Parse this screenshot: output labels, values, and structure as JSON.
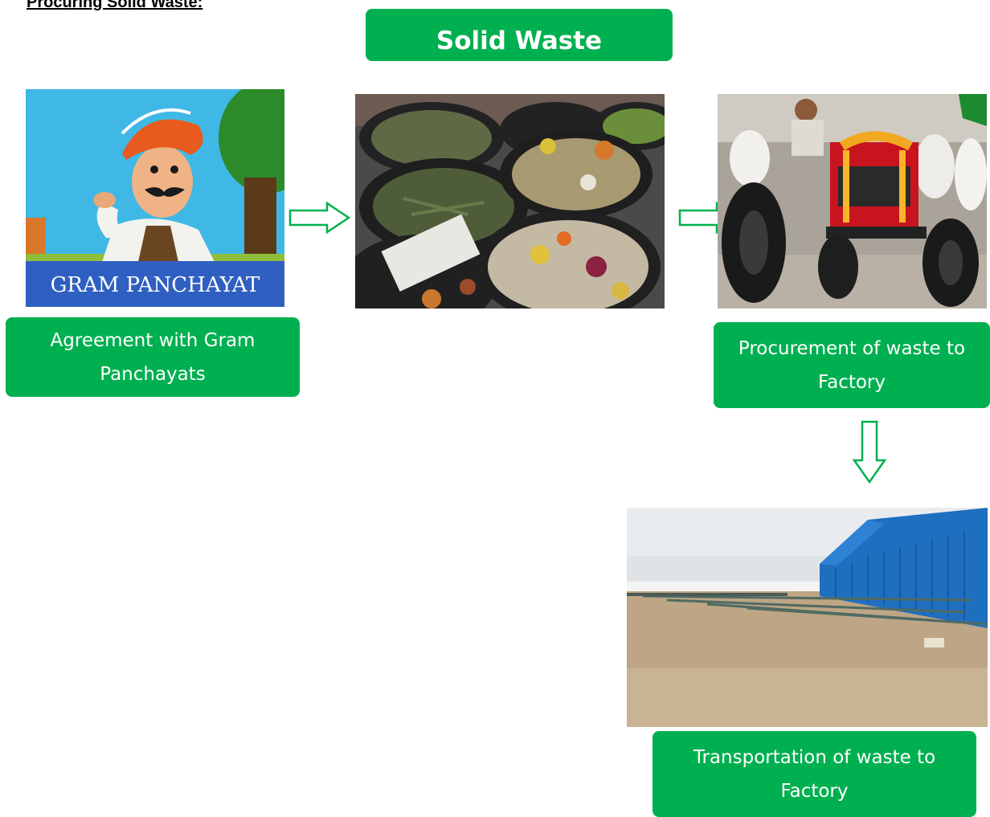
{
  "document": {
    "heading": "Procuring Solid Waste:",
    "title": "Solid Waste"
  },
  "flow": {
    "step1": {
      "image_text": "GRAM PANCHAYAT",
      "label": "Agreement with Gram Panchayats"
    },
    "step3": {
      "label": "Procurement of waste to Factory"
    },
    "step4": {
      "label": "Transportation of waste to Factory"
    }
  },
  "colors": {
    "box_green": "#00b050",
    "arrow_green": "#00b050",
    "text_white": "#ffffff"
  }
}
